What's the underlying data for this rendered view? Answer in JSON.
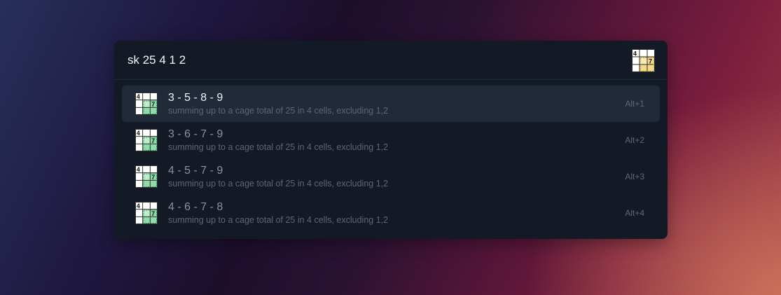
{
  "search": {
    "query": "sk 25 4 1 2"
  },
  "app_icon": {
    "name": "killer-sudoku-icon",
    "digit_top": "4",
    "digit_mid": "7",
    "accent": "#f5d98a"
  },
  "row_icon": {
    "name": "killer-sudoku-icon",
    "digit_top": "4",
    "digit_mid": "7",
    "accent": "#8fdcaa"
  },
  "results": [
    {
      "title": "3 - 5 - 8 - 9",
      "subtitle": "summing up to a cage total of 25 in 4 cells, excluding 1,2",
      "shortcut": "Alt+1",
      "selected": true
    },
    {
      "title": "3 - 6 - 7 - 9",
      "subtitle": "summing up to a cage total of 25 in 4 cells, excluding 1,2",
      "shortcut": "Alt+2",
      "selected": false
    },
    {
      "title": "4 - 5 - 7 - 9",
      "subtitle": "summing up to a cage total of 25 in 4 cells, excluding 1,2",
      "shortcut": "Alt+3",
      "selected": false
    },
    {
      "title": "4 - 6 - 7 - 8",
      "subtitle": "summing up to a cage total of 25 in 4 cells, excluding 1,2",
      "shortcut": "Alt+4",
      "selected": false
    }
  ],
  "colors": {
    "window_bg": "#131a26",
    "selected_row_bg": "#212a38",
    "highlight_cells_app": "#f5d98a",
    "highlight_cells_rows": "#8fdcaa"
  }
}
